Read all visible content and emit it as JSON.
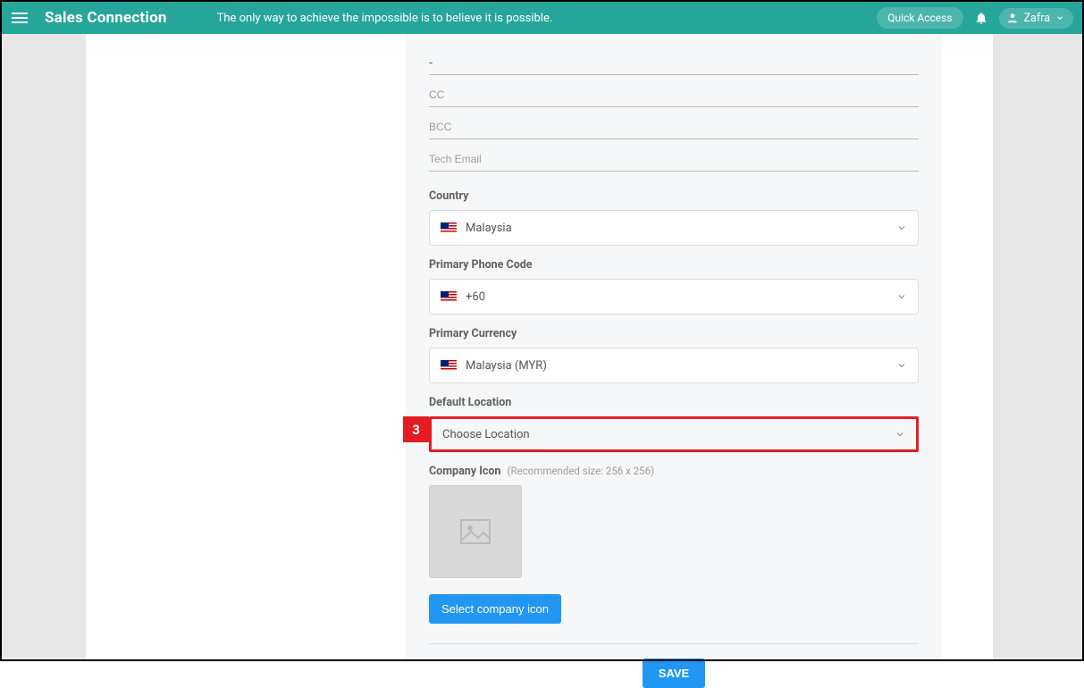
{
  "header": {
    "brand": "Sales Connection",
    "tagline": "The only way to achieve the impossible is to believe it is possible.",
    "quick_access": "Quick Access",
    "user_name": "Zafra"
  },
  "form": {
    "dash_value": "-",
    "cc_placeholder": "CC",
    "bcc_placeholder": "BCC",
    "tech_email_placeholder": "Tech Email",
    "country_label": "Country",
    "country_value": "Malaysia",
    "phone_code_label": "Primary Phone Code",
    "phone_code_value": "+60",
    "currency_label": "Primary Currency",
    "currency_value": "Malaysia  (MYR)",
    "default_location_label": "Default Location",
    "default_location_placeholder": "Choose Location",
    "company_icon_label": "Company Icon",
    "company_icon_hint": "(Recommended size: 256 x 256)",
    "select_icon_button": "Select company icon",
    "save_button": "SAVE"
  },
  "annotation": {
    "step_number": "3"
  }
}
